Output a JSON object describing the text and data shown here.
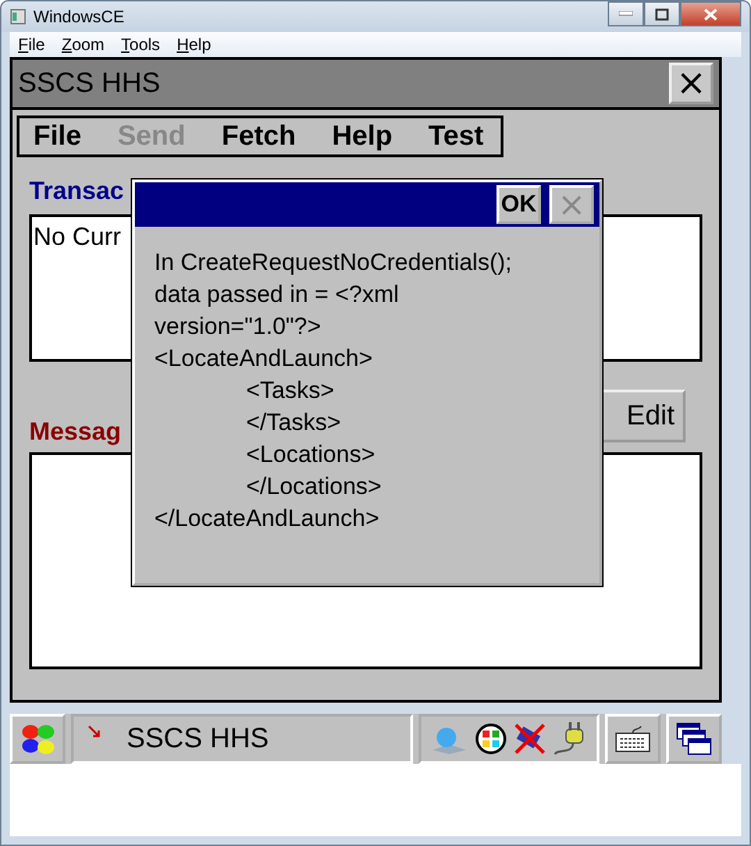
{
  "window": {
    "title": "WindowsCE"
  },
  "menubar": [
    {
      "label": "File"
    },
    {
      "label": "Zoom"
    },
    {
      "label": "Tools"
    },
    {
      "label": "Help"
    }
  ],
  "app": {
    "title": "SSCS HHS",
    "close": "×",
    "menu": [
      {
        "label": "File",
        "disabled": false
      },
      {
        "label": "Send",
        "disabled": true
      },
      {
        "label": "Fetch",
        "disabled": false
      },
      {
        "label": "Help",
        "disabled": false
      },
      {
        "label": "Test",
        "disabled": false
      }
    ],
    "transaction_label": "Transac",
    "transaction_text": "No Curr",
    "edit_button": "Edit",
    "messages_label": "Messag"
  },
  "dialog": {
    "ok": "OK",
    "close": "×",
    "intro": "In CreateRequestNoCredentials(); data passed in = <?xml version=\"1.0\"?>",
    "lines": [
      {
        "text": "<LocateAndLaunch>",
        "children": [
          {
            "text": "<Tasks>"
          },
          {
            "text": "</Tasks>"
          },
          {
            "text": "<Locations>"
          },
          {
            "text": "</Locations>"
          }
        ]
      },
      {
        "text": "</LocateAndLaunch>"
      }
    ]
  },
  "taskbar": {
    "task": "SSCS HHS"
  }
}
